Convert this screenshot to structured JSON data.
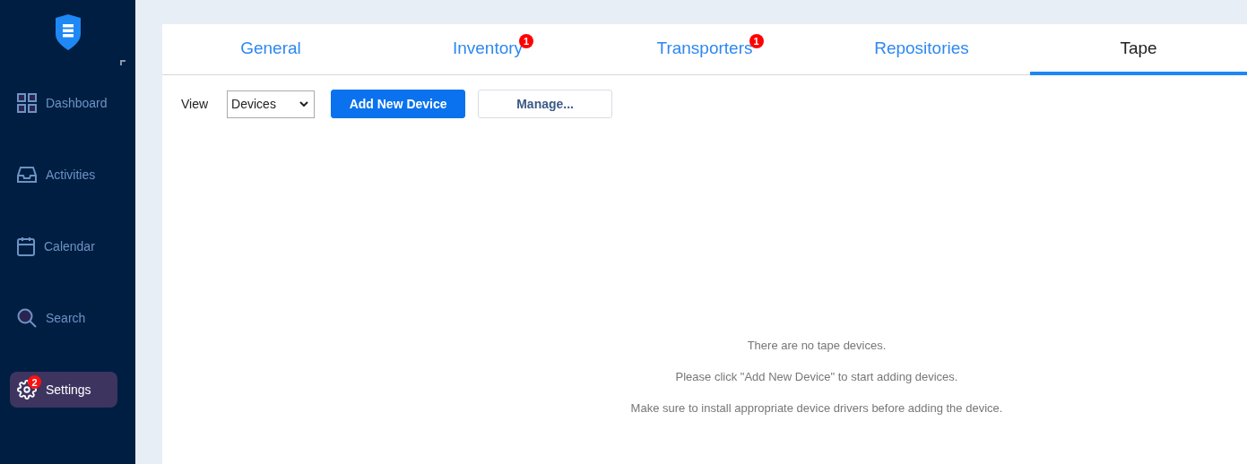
{
  "sidebar": {
    "items": [
      {
        "kind": "dashboard",
        "label": "Dashboard",
        "selected": false
      },
      {
        "kind": "activities",
        "label": "Activities",
        "selected": false
      },
      {
        "kind": "calendar",
        "label": "Calendar",
        "selected": false
      },
      {
        "kind": "search",
        "label": "Search",
        "selected": false
      },
      {
        "kind": "settings",
        "label": "Settings",
        "selected": true,
        "badge": "2"
      }
    ]
  },
  "tabs": [
    {
      "label": "General",
      "selected": false
    },
    {
      "label": "Inventory",
      "selected": false,
      "badge": "1"
    },
    {
      "label": "Transporters",
      "selected": false,
      "badge": "1"
    },
    {
      "label": "Repositories",
      "selected": false
    },
    {
      "label": "Tape",
      "selected": true
    }
  ],
  "toolbar": {
    "view_label": "View",
    "view_value": "Devices",
    "add_button": "Add New Device",
    "manage_button": "Manage..."
  },
  "empty_messages": [
    "There are no tape devices.",
    "Please click \"Add New Device\" to start adding devices.",
    "Make sure to install appropriate device drivers before adding the device."
  ]
}
